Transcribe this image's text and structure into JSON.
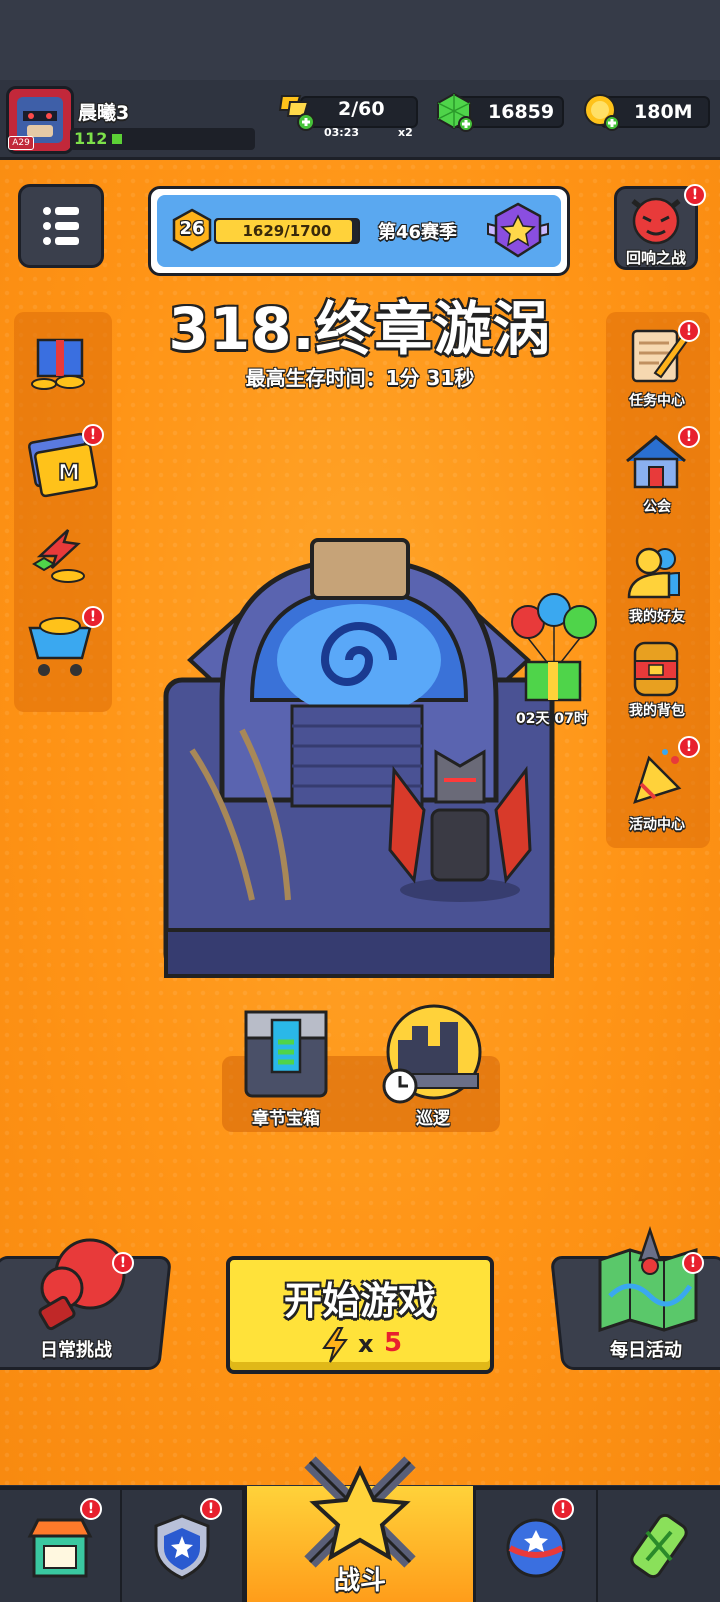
{
  "player": {
    "name": "晨曦3",
    "level_badge": "A29",
    "power": "112"
  },
  "resources": {
    "energy": "2/60",
    "energy_timer": "03:23",
    "energy_mult": "x2",
    "gems": "16859",
    "gold": "180M"
  },
  "season": {
    "level": "26",
    "xp": "1629/1700",
    "xp_fraction": 0.958,
    "label": "第46赛季"
  },
  "chapter": {
    "title": "318.终章漩涡",
    "best_time": "最高生存时间：1分 31秒"
  },
  "right_menu": {
    "echo_battle": "回响之战",
    "tasks": "任务中心",
    "guild": "公会",
    "friends": "我的好友",
    "bag": "我的背包",
    "events": "活动中心"
  },
  "gift_timer": "02天 07时",
  "chest": {
    "chapter_chest": "章节宝箱",
    "patrol": "巡逻"
  },
  "bottom_actions": {
    "daily_challenge": "日常挑战",
    "start_game": "开始游戏",
    "cost_mult": "x",
    "cost_value": "5",
    "daily_events": "每日活动"
  },
  "nav": {
    "battle": "战斗"
  },
  "colors": {
    "orange_bg": "#ff9416",
    "start_button": "#ffe23a",
    "badge_red": "#e8202e",
    "season_blue": "#5aa8f0"
  }
}
